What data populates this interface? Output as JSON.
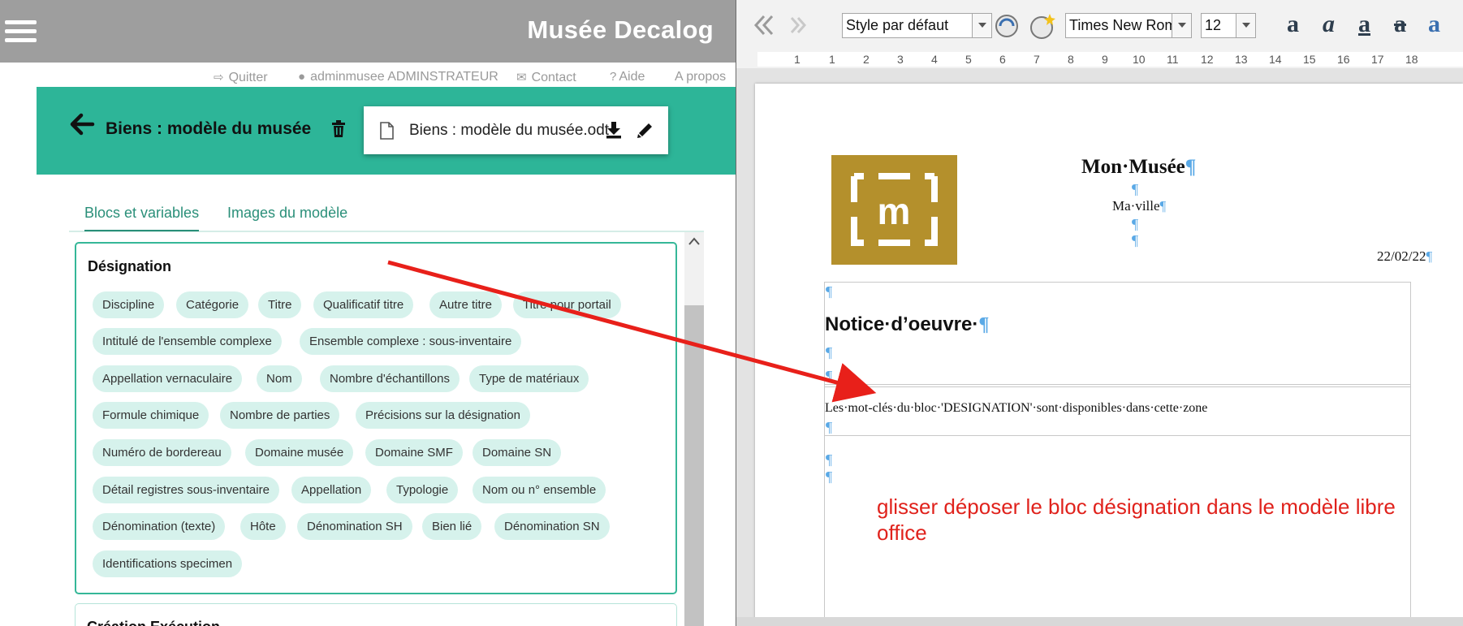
{
  "app": {
    "title": "Musée Decalog"
  },
  "usernav": {
    "quit": "Quitter",
    "user": "adminmusee ADMINSTRATEUR",
    "contact": "Contact",
    "help": "Aide",
    "about": "A propos"
  },
  "model": {
    "title": "Biens : modèle du musée",
    "file_name": "Biens : modèle du musée.odt"
  },
  "tabs": [
    {
      "label": "Blocs et variables",
      "active": true
    },
    {
      "label": "Images du modèle",
      "active": false
    }
  ],
  "block": {
    "title": "Désignation",
    "chips": [
      "Discipline",
      "Catégorie",
      "Titre",
      "Qualificatif titre",
      "Autre titre",
      "Titre pour portail",
      "Intitulé de l'ensemble complexe",
      "Ensemble complexe : sous-inventaire",
      "Appellation vernaculaire",
      "Nom",
      "Nombre d'échantillons",
      "Type de matériaux",
      "Formule chimique",
      "Nombre de parties",
      "Précisions sur la désignation",
      "Numéro de bordereau",
      "Domaine musée",
      "Domaine SMF",
      "Domaine SN",
      "Détail registres sous-inventaire",
      "Appellation",
      "Typologie",
      "Nom ou n° ensemble",
      "Dénomination (texte)",
      "Hôte",
      "Dénomination SH",
      "Bien lié",
      "Dénomination SN",
      "Identifications specimen"
    ]
  },
  "block2": {
    "title": "Création Exécution"
  },
  "libreoffice": {
    "paragraph_style": "Style par défaut",
    "font_name": "Times New Roman",
    "font_size": "12",
    "ruler_numbers": [
      "1",
      "1",
      "2",
      "3",
      "4",
      "5",
      "6",
      "7",
      "8",
      "9",
      "10",
      "11",
      "12",
      "13",
      "14",
      "15",
      "16",
      "17",
      "18"
    ],
    "pilcrow": "¶"
  },
  "document": {
    "title": "Mon·Musée",
    "city": "Ma·ville",
    "date": "22/02/22",
    "logo_letter": "m",
    "notice_title": "Notice·d’oeuvre·",
    "zone_text": "Les·mot-clés·du·bloc·'DESIGNATION'·sont·disponibles·dans·cette·zone"
  },
  "annotation": {
    "text": "glisser déposer le bloc désignation dans le modèle libre office",
    "color": "#e0221c"
  },
  "colors": {
    "accent": "#2db598",
    "topbar": "#9e9e9e",
    "chip_bg": "#d6f2ec",
    "logo": "#b4902c"
  }
}
